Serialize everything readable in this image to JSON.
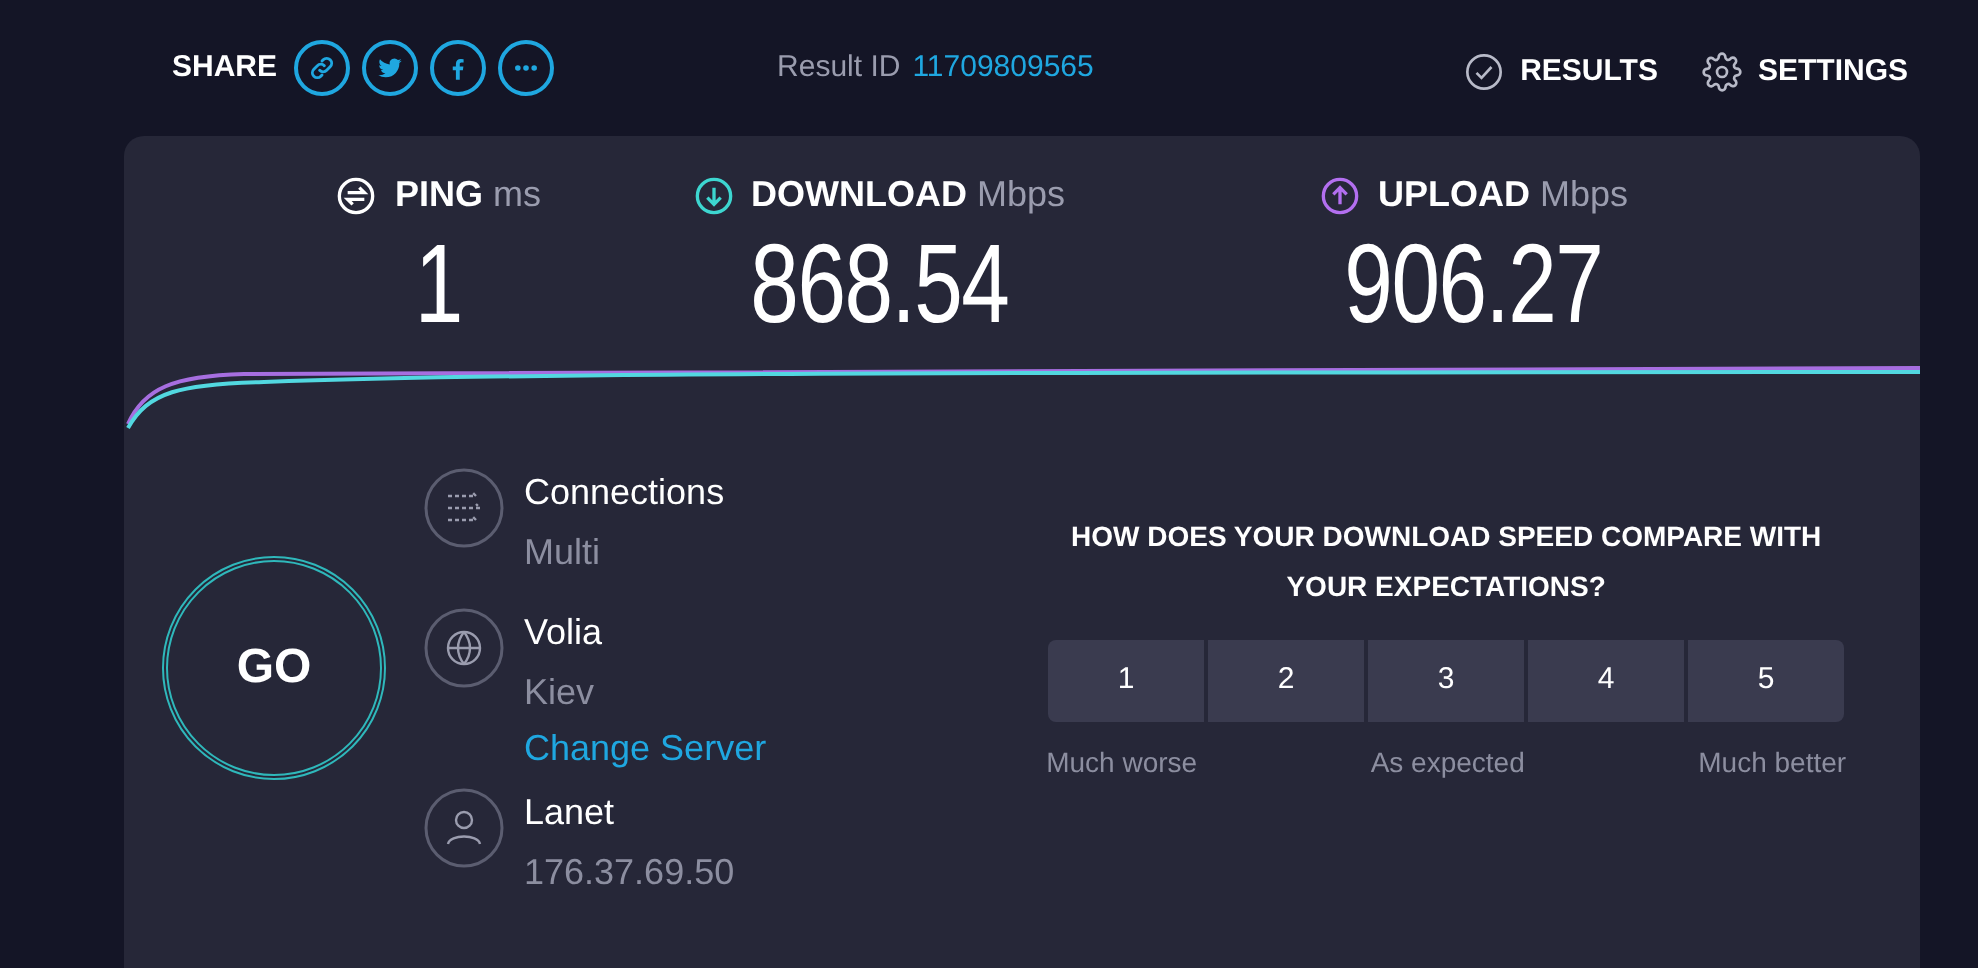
{
  "header": {
    "share_label": "SHARE",
    "share_buttons": [
      {
        "kind": "link"
      },
      {
        "kind": "twitter"
      },
      {
        "kind": "facebook"
      },
      {
        "kind": "more"
      }
    ],
    "result_label": "Result ID",
    "result_id": "11709809565",
    "nav": [
      {
        "kind": "results",
        "label": "RESULTS"
      },
      {
        "kind": "settings",
        "label": "SETTINGS"
      }
    ]
  },
  "metrics": [
    {
      "kind": "ping",
      "label": "PING",
      "unit": "ms",
      "value": "1"
    },
    {
      "kind": "download",
      "label": "DOWNLOAD",
      "unit": "Mbps",
      "value": "868.54"
    },
    {
      "kind": "upload",
      "label": "UPLOAD",
      "unit": "Mbps",
      "value": "906.27"
    }
  ],
  "go_button": "GO",
  "details": [
    {
      "kind": "connections",
      "title": "Connections",
      "subtitle": "Multi"
    },
    {
      "kind": "server",
      "title": "Volia",
      "subtitle": "Kiev",
      "link": "Change Server"
    },
    {
      "kind": "host",
      "title": "Lanet",
      "subtitle": "176.37.69.50"
    }
  ],
  "survey": {
    "question": "HOW DOES YOUR DOWNLOAD SPEED COMPARE WITH YOUR EXPECTATIONS?",
    "options": [
      {
        "label": "1",
        "selected": false
      },
      {
        "label": "2",
        "selected": false
      },
      {
        "label": "3",
        "selected": false
      },
      {
        "label": "4",
        "selected": false
      },
      {
        "label": "5",
        "selected": false
      }
    ],
    "scale_labels": [
      "Much worse",
      "As expected",
      "Much better"
    ]
  }
}
